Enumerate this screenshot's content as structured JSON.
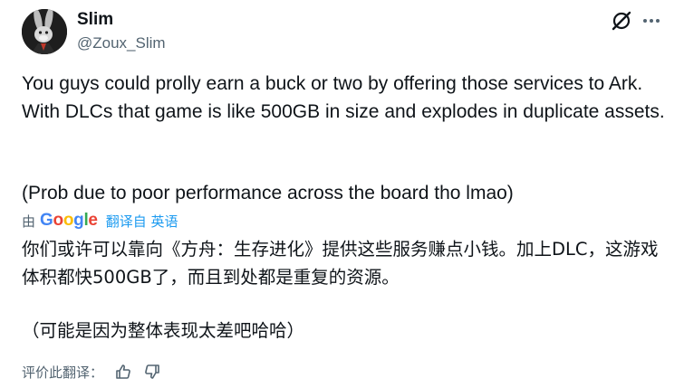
{
  "author": {
    "name": "Slim",
    "handle": "@Zoux_Slim"
  },
  "icons": {
    "grok": "grok-icon",
    "more": "more-icon",
    "thumbs_up": "thumbs-up-icon",
    "thumbs_down": "thumbs-down-icon"
  },
  "post": {
    "original_paragraph_1": "You guys could prolly earn a buck or two by offering those services to Ark. With DLCs that game is like 500GB in size and explodes in duplicate assets.",
    "original_paragraph_2": "(Prob due to poor performance across the board tho lmao)"
  },
  "translation": {
    "by_prefix": "由",
    "provider": "Google",
    "action_label": "翻译自 英语",
    "paragraph_1": "你们或许可以靠向《方舟：生存进化》提供这些服务赚点小钱。加上DLC，这游戏体积都快500GB了，而且到处都是重复的资源。",
    "paragraph_2": "（可能是因为整体表现太差吧哈哈）",
    "rate_label": "评价此翻译："
  },
  "colors": {
    "text": "#0f1419",
    "secondary": "#536471",
    "link": "#1d9bf0"
  }
}
